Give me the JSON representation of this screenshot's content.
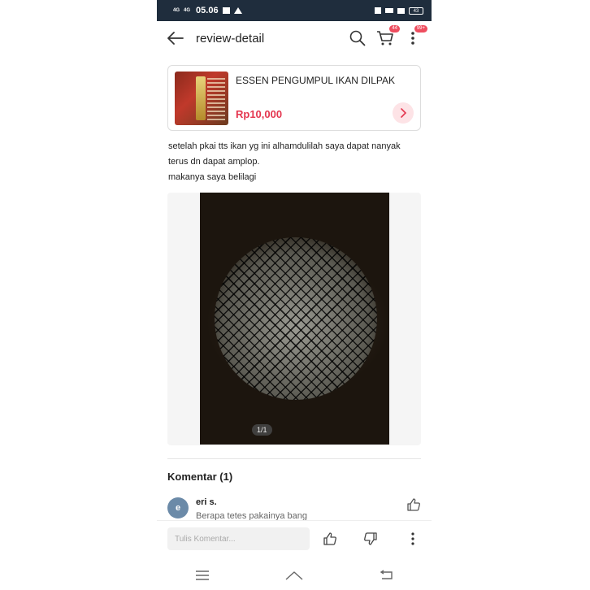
{
  "status_bar": {
    "network_1": "4G",
    "network_2": "4G",
    "time": "05.06",
    "battery": "43"
  },
  "header": {
    "title": "review-detail",
    "cart_badge": "44",
    "menu_badge": "99+"
  },
  "product": {
    "name": "ESSEN PENGUMPUL IKAN DILPAK",
    "price": "Rp10,000"
  },
  "review": {
    "line_1": "setelah pkai tts ikan yg ini alhamdulilah saya dapat nanyak",
    "line_2": "terus dn dapat amplop.",
    "line_3": "makanya saya belilagi"
  },
  "photo": {
    "counter": "1/1"
  },
  "comments": {
    "title": "Komentar (1)",
    "items": [
      {
        "avatar_letter": "e",
        "name": "eri s.",
        "text": "Berapa tetes pakainya bang"
      }
    ]
  },
  "input_bar": {
    "placeholder": "Tulis Komentar..."
  },
  "colors": {
    "accent": "#e4364f",
    "status_bar": "#1f2d3d",
    "avatar": "#6b8aa8"
  },
  "icons": [
    "back-arrow-icon",
    "search-icon",
    "cart-icon",
    "more-vertical-icon",
    "chevron-right-icon",
    "thumbs-up-icon",
    "thumbs-down-icon",
    "menu-icon",
    "home-icon",
    "back-icon"
  ]
}
